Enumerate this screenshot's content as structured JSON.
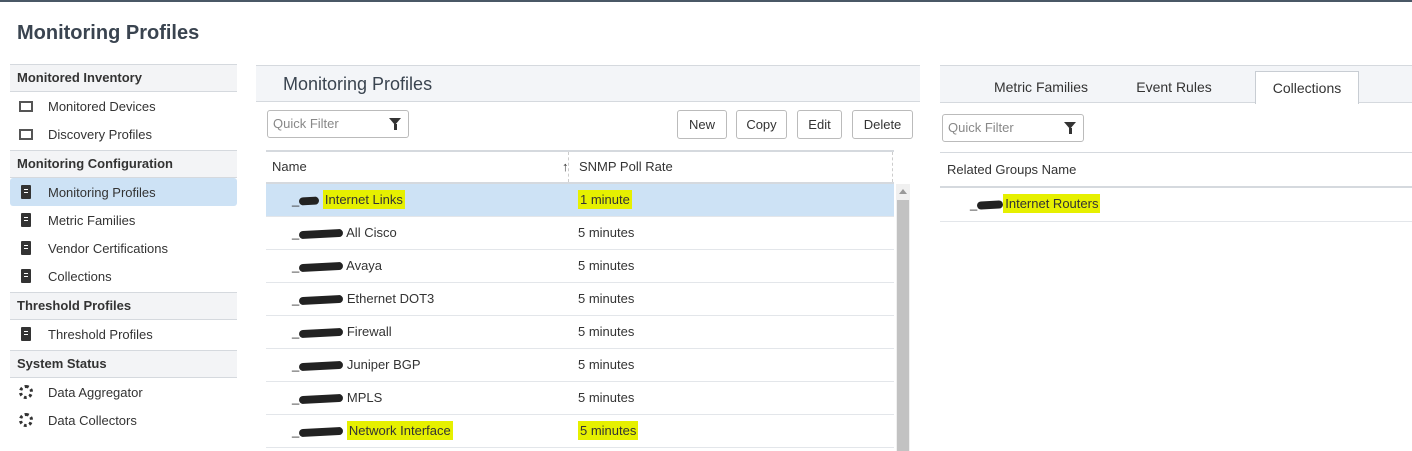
{
  "page": {
    "title": "Monitoring Profiles"
  },
  "sidebar": {
    "sections": [
      {
        "label": "Monitored Inventory",
        "items": [
          {
            "label": "Monitored Devices",
            "icon": "device-icon"
          },
          {
            "label": "Discovery Profiles",
            "icon": "device-icon"
          }
        ]
      },
      {
        "label": "Monitoring Configuration",
        "items": [
          {
            "label": "Monitoring Profiles",
            "icon": "document-icon",
            "active": true
          },
          {
            "label": "Metric Families",
            "icon": "document-icon"
          },
          {
            "label": "Vendor Certifications",
            "icon": "document-icon"
          },
          {
            "label": "Collections",
            "icon": "document-icon"
          }
        ]
      },
      {
        "label": "Threshold Profiles",
        "items": [
          {
            "label": "Threshold Profiles",
            "icon": "document-icon"
          }
        ]
      },
      {
        "label": "System Status",
        "items": [
          {
            "label": "Data Aggregator",
            "icon": "status-icon"
          },
          {
            "label": "Data Collectors",
            "icon": "status-icon"
          }
        ]
      }
    ]
  },
  "main": {
    "title": "Monitoring Profiles",
    "filter_placeholder": "Quick Filter",
    "buttons": {
      "new": "New",
      "copy": "Copy",
      "edit": "Edit",
      "delete": "Delete"
    },
    "columns": {
      "name": "Name",
      "poll": "SNMP Poll Rate"
    },
    "rows": [
      {
        "prefix": "_",
        "name": "Internet Links",
        "poll": "1 minute"
      },
      {
        "prefix": "_",
        "name": "All Cisco",
        "poll": "5 minutes"
      },
      {
        "prefix": "_",
        "name": "Avaya",
        "poll": "5 minutes"
      },
      {
        "prefix": "_",
        "name": "Ethernet DOT3",
        "poll": "5 minutes"
      },
      {
        "prefix": "_",
        "name": "Firewall",
        "poll": "5 minutes"
      },
      {
        "prefix": "_",
        "name": "Juniper BGP",
        "poll": "5 minutes"
      },
      {
        "prefix": "_",
        "name": "MPLS",
        "poll": "5 minutes"
      },
      {
        "prefix": "_",
        "name": "Network Interface",
        "poll": "5 minutes"
      }
    ]
  },
  "right": {
    "tabs": [
      "Metric Families",
      "Event Rules",
      "Collections"
    ],
    "active_tab": "Collections",
    "filter_placeholder": "Quick Filter",
    "column": "Related Groups Name",
    "rows": [
      {
        "prefix": "_",
        "name": "Internet Routers"
      }
    ]
  },
  "colors": {
    "highlight": "#e6f000",
    "selected": "#cde2f5"
  }
}
